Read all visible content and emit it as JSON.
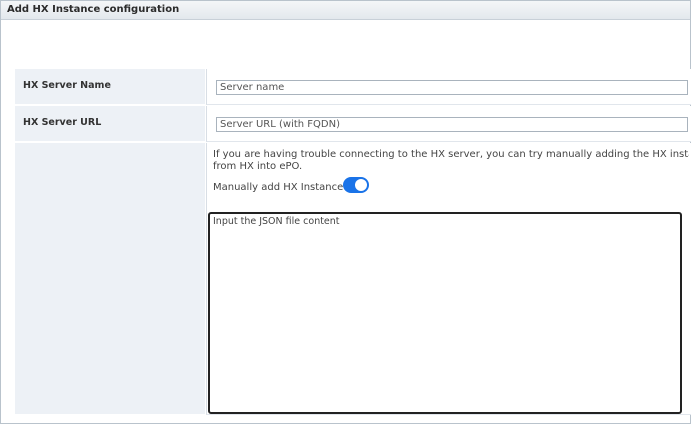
{
  "panel": {
    "title": "Add HX Instance configuration"
  },
  "fields": {
    "server_name": {
      "label": "HX Server Name",
      "value": "",
      "placeholder": "Server name"
    },
    "server_url": {
      "label": "HX Server URL",
      "value": "",
      "placeholder": "Server URL (with FQDN)"
    }
  },
  "manual": {
    "help_line1": "If you are having trouble connecting to the HX server, you can try manually adding the HX instance",
    "help_line2": "from HX into ePO.",
    "toggle_label": "Manually add HX Instance",
    "toggle_on": true,
    "json_placeholder": "Input the JSON file content"
  },
  "colors": {
    "toggle_on": "#1a73e8",
    "label_cell_bg": "#edf1f6"
  }
}
